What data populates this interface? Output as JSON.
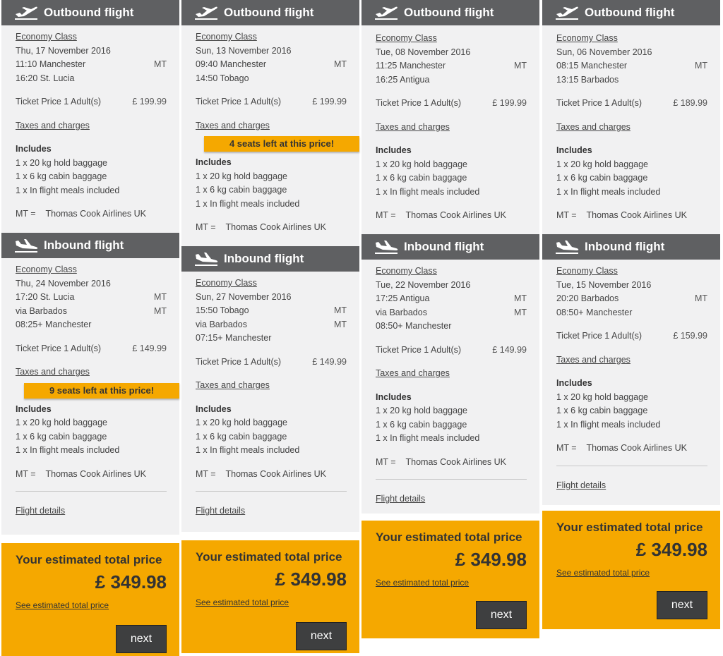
{
  "labels": {
    "outbound": "Outbound flight",
    "inbound": "Inbound flight",
    "economy": "Economy Class",
    "ticket_price": "Ticket Price 1 Adult(s)",
    "taxes": "Taxes and charges",
    "includes": "Includes",
    "hold": "1 x 20 kg hold baggage",
    "cabin": "1 x 6 kg cabin baggage",
    "meals": "1 x In flight meals included",
    "mt_prefix": "MT =",
    "mt_airline": "Thomas Cook Airlines UK",
    "flight_details": "Flight details",
    "est_total": "Your estimated total price",
    "see_total": "See estimated total price",
    "next": "next",
    "mt": "MT"
  },
  "cards": [
    {
      "out": {
        "date": "Thu, 17 November 2016",
        "dep": "11:10 Manchester",
        "arr": "16:20 St. Lucia",
        "price": "£ 199.99"
      },
      "in": {
        "date": "Thu, 24 November 2016",
        "dep": "17:20 St. Lucia",
        "via": "via Barbados",
        "arr": "08:25+ Manchester",
        "price": "£ 149.99"
      },
      "seats_in": "9 seats left at this price!",
      "total": "£ 349.98"
    },
    {
      "out": {
        "date": "Sun, 13 November 2016",
        "dep": "09:40 Manchester",
        "arr": "14:50 Tobago",
        "price": "£ 199.99"
      },
      "in": {
        "date": "Sun, 27 November 2016",
        "dep": "15:50 Tobago",
        "via": "via Barbados",
        "arr": "07:15+ Manchester",
        "price": "£ 149.99"
      },
      "seats_out": "4 seats left at this price!",
      "total": "£ 349.98"
    },
    {
      "out": {
        "date": "Tue, 08 November 2016",
        "dep": "11:25 Manchester",
        "arr": "16:25 Antigua",
        "price": "£ 199.99"
      },
      "in": {
        "date": "Tue, 22 November 2016",
        "dep": "17:25 Antigua",
        "via": "via Barbados",
        "arr": "08:50+ Manchester",
        "price": "£ 149.99"
      },
      "total": "£ 349.98"
    },
    {
      "out": {
        "date": "Sun, 06 November 2016",
        "dep": "08:15 Manchester",
        "arr": "13:15 Barbados",
        "price": "£ 189.99"
      },
      "in": {
        "date": "Tue, 15 November 2016",
        "dep": "20:20 Barbados",
        "arr": "08:50+ Manchester",
        "price": "£ 159.99"
      },
      "total": "£ 349.98"
    }
  ],
  "colors": {
    "header": "#5f6062",
    "panel": "#f1f1f2",
    "accent": "#f5a800",
    "button": "#3e3f40"
  }
}
